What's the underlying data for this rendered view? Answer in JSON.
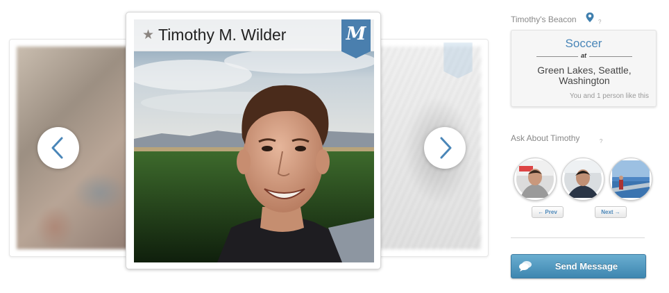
{
  "profile": {
    "name": "Timothy M. Wilder",
    "ribbon_letter": "M",
    "accent_color": "#4a7fae"
  },
  "carousel": {
    "prev_icon": "chevron-left-icon",
    "next_icon": "chevron-right-icon"
  },
  "beacon": {
    "title": "Timothy's Beacon",
    "help": "?",
    "activity": "Soccer",
    "at_label": "at",
    "location": "Green Lakes, Seattle, Washington",
    "likes": "You and 1 person like this"
  },
  "ask": {
    "title": "Ask About Timothy",
    "help": "?",
    "prev_label": "← Prev",
    "next_label": "Next →"
  },
  "actions": {
    "send_message": "Send Message",
    "button_color": "#4a90bb"
  }
}
